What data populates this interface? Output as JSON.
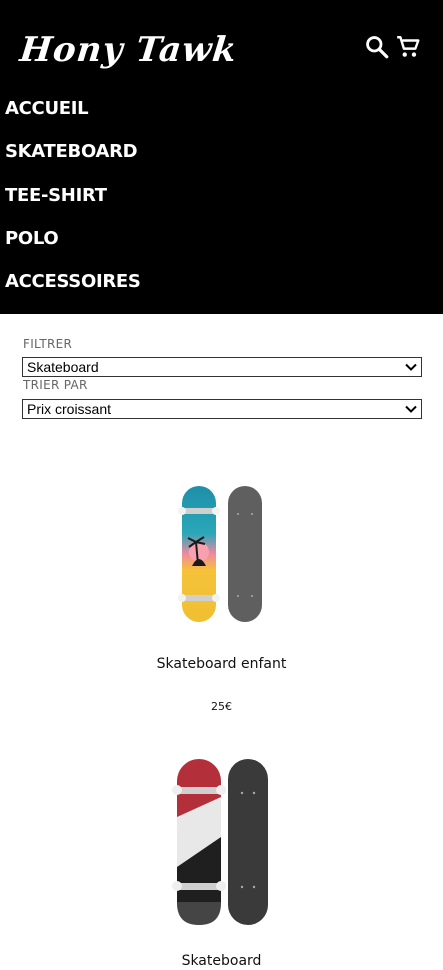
{
  "header": {
    "logo": "Hony Tawk",
    "icons": {
      "search": "search-icon",
      "cart": "cart-icon"
    }
  },
  "nav": {
    "items": [
      "ACCUEIL",
      "SKATEBOARD",
      "TEE-SHIRT",
      "POLO",
      "ACCESSOIRES"
    ]
  },
  "filters": {
    "filter_label": "FILTRER",
    "filter_value": "Skateboard",
    "sort_label": "TRIER PAR",
    "sort_value": "Prix croissant"
  },
  "products": [
    {
      "name": "Skateboard enfant",
      "price": "25€"
    },
    {
      "name": "Skateboard",
      "price": ""
    }
  ],
  "colors": {
    "header_bg": "#000000",
    "text_on_header": "#ffffff"
  }
}
